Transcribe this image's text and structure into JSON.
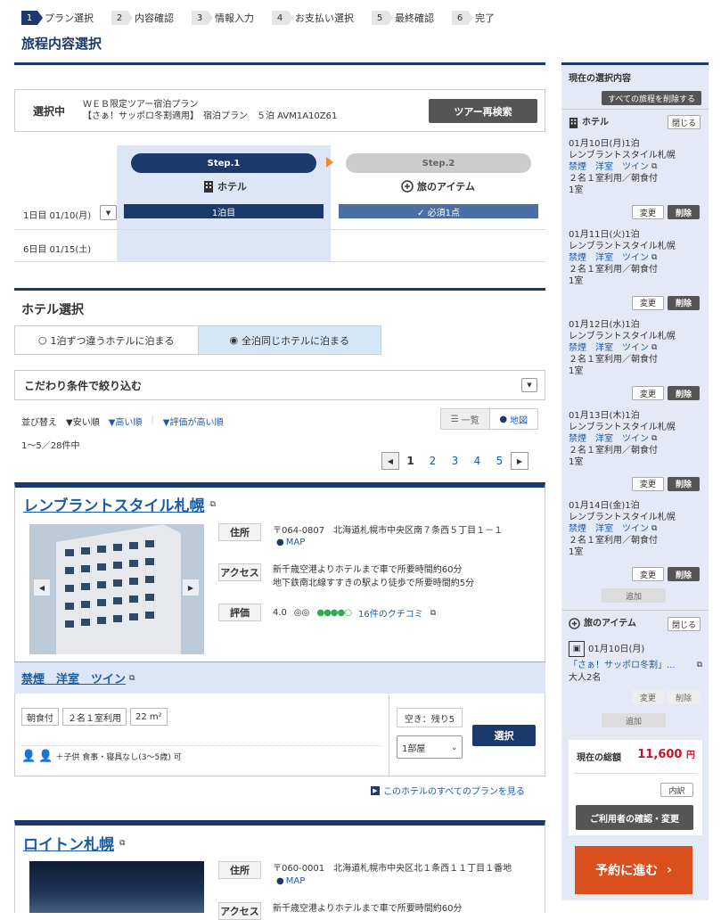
{
  "steps": [
    {
      "num": "1",
      "label": "プラン選択"
    },
    {
      "num": "2",
      "label": "内容確認"
    },
    {
      "num": "3",
      "label": "情報入力"
    },
    {
      "num": "4",
      "label": "お支払い選択"
    },
    {
      "num": "5",
      "label": "最終確認"
    },
    {
      "num": "6",
      "label": "完了"
    }
  ],
  "page_title": "旅程内容選択",
  "selected": {
    "label": "選択中",
    "line1": "ＷＥＢ限定ツアー宿泊プラン",
    "line2": "【さぁ！サッポロ冬割適用】　宿泊プラン　５泊 AVM1A10Z61",
    "research_button": "ツアー再検索"
  },
  "schedule": {
    "step1": "Step.1",
    "step1_label": "ホテル",
    "step2": "Step.2",
    "step2_label": "旅のアイテム",
    "day1": "1日目 01/10(月)",
    "day1_nights": "1泊目",
    "day1_required": "✓ 必須1点",
    "day6": "6日目 01/15(土)"
  },
  "hotel_select": {
    "title": "ホテル選択",
    "radio1": "1泊ずつ違うホテルに泊まる",
    "radio2": "全泊同じホテルに泊まる",
    "filter_title": "こだわり条件で絞り込む",
    "sort_label": "並び替え",
    "sort_cheap": "▼安い順",
    "sort_expensive": "▼高い順",
    "sort_rating": "▼評価が高い順",
    "view_list": "一覧",
    "view_map": "地図",
    "count": "1～5／28件中",
    "pages": [
      "1",
      "2",
      "3",
      "4",
      "5"
    ]
  },
  "hotel1": {
    "name": "レンブラントスタイル札幌",
    "addr_label": "住所",
    "address": "〒064-0807　北海道札幌市中央区南７条西５丁目１－１",
    "map": "MAP",
    "access_label": "アクセス",
    "access1": "新千歳空港よりホテルまで車で所要時間約60分",
    "access2": "地下鉄南北線すすきの駅より徒歩で所要時間約5分",
    "rating_label": "評価",
    "rating": "4.0",
    "reviews": "16件のクチコミ",
    "room": "禁煙　洋室　ツイン",
    "tag1": "朝食付",
    "tag2": "２名１室利用",
    "tag3": "22 m²",
    "vacancy": "空き：残り5",
    "rooms_select": "1部屋",
    "select_button": "選択",
    "child": "＋子供 食事・寝具なし(3～5歳) 可",
    "all_plans": "このホテルのすべてのプランを見る"
  },
  "hotel2": {
    "name": "ロイトン札幌",
    "addr_label": "住所",
    "address": "〒060-0001　北海道札幌市中央区北１条西１１丁目１番地",
    "map": "MAP",
    "access_label": "アクセス",
    "access1": "新千歳空港よりホテルまで車で所要時間約60分"
  },
  "sidebar": {
    "title": "現在の選択内容",
    "delete_all": "すべての旅程を削除する",
    "hotel_label": "ホテル",
    "close": "閉じる",
    "entries": [
      {
        "date": "01月10日(月)1泊",
        "hotel": "レンブラントスタイル札幌",
        "room": "禁煙　洋室　ツイン",
        "use": "２名１室利用／朝食付",
        "rooms": "1室"
      },
      {
        "date": "01月11日(火)1泊",
        "hotel": "レンブラントスタイル札幌",
        "room": "禁煙　洋室　ツイン",
        "use": "２名１室利用／朝食付",
        "rooms": "1室"
      },
      {
        "date": "01月12日(水)1泊",
        "hotel": "レンブラントスタイル札幌",
        "room": "禁煙　洋室　ツイン",
        "use": "２名１室利用／朝食付",
        "rooms": "1室"
      },
      {
        "date": "01月13日(木)1泊",
        "hotel": "レンブラントスタイル札幌",
        "room": "禁煙　洋室　ツイン",
        "use": "２名１室利用／朝食付",
        "rooms": "1室"
      },
      {
        "date": "01月14日(金)1泊",
        "hotel": "レンブラントスタイル札幌",
        "room": "禁煙　洋室　ツイン",
        "use": "２名１室利用／朝食付",
        "rooms": "1室"
      }
    ],
    "change": "変更",
    "delete": "削除",
    "add": "追加",
    "item_label": "旅のアイテム",
    "item_date": "01月10日(月)",
    "item_name": "「さぁ！サッポロ冬割」...",
    "item_people": "大人2名",
    "total_label": "現在の総額",
    "total": "11,600",
    "yen": "円",
    "breakdown": "内訳",
    "confirm_users": "ご利用者の確認・変更",
    "proceed": "予約に進む"
  },
  "colors": {
    "navy": "#1b3a6b",
    "link": "#1a5ba6",
    "accent": "#d94f1e",
    "price": "#c8102e",
    "lightblue": "#dde6f6"
  }
}
